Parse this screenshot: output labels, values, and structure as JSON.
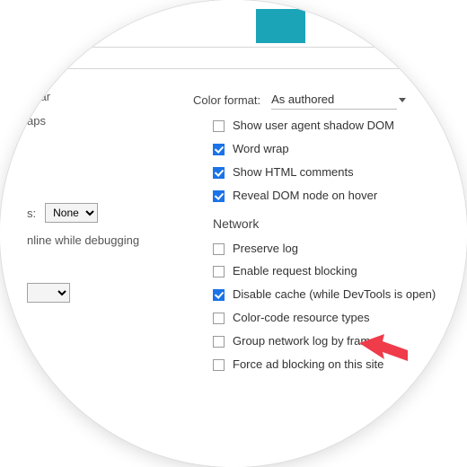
{
  "colorFormat": {
    "label": "Color format:",
    "value": "As authored"
  },
  "elements": {
    "showShadowDom": {
      "label": "Show user agent shadow DOM",
      "checked": false
    },
    "wordWrap": {
      "label": "Word wrap",
      "checked": true
    },
    "showComments": {
      "label": "Show HTML comments",
      "checked": true
    },
    "revealOnHover": {
      "label": "Reveal DOM node on hover",
      "checked": true
    }
  },
  "networkHeading": "Network",
  "network": {
    "preserveLog": {
      "label": "Preserve log",
      "checked": false
    },
    "enableBlocking": {
      "label": "Enable request blocking",
      "checked": false
    },
    "disableCache": {
      "label": "Disable cache (while DevTools is open)",
      "checked": true
    },
    "colorCode": {
      "label": "Color-code resource types",
      "checked": false
    },
    "groupByFrame": {
      "label": "Group network log by frame",
      "checked": false
    },
    "forceAdBlock": {
      "label": "Force ad blocking on this site",
      "checked": false
    }
  },
  "left": {
    "frag1": "ebar",
    "frag2": "aps",
    "selLabel": "s:",
    "selValue": "None",
    "offlineWhile": "nline while debugging"
  }
}
